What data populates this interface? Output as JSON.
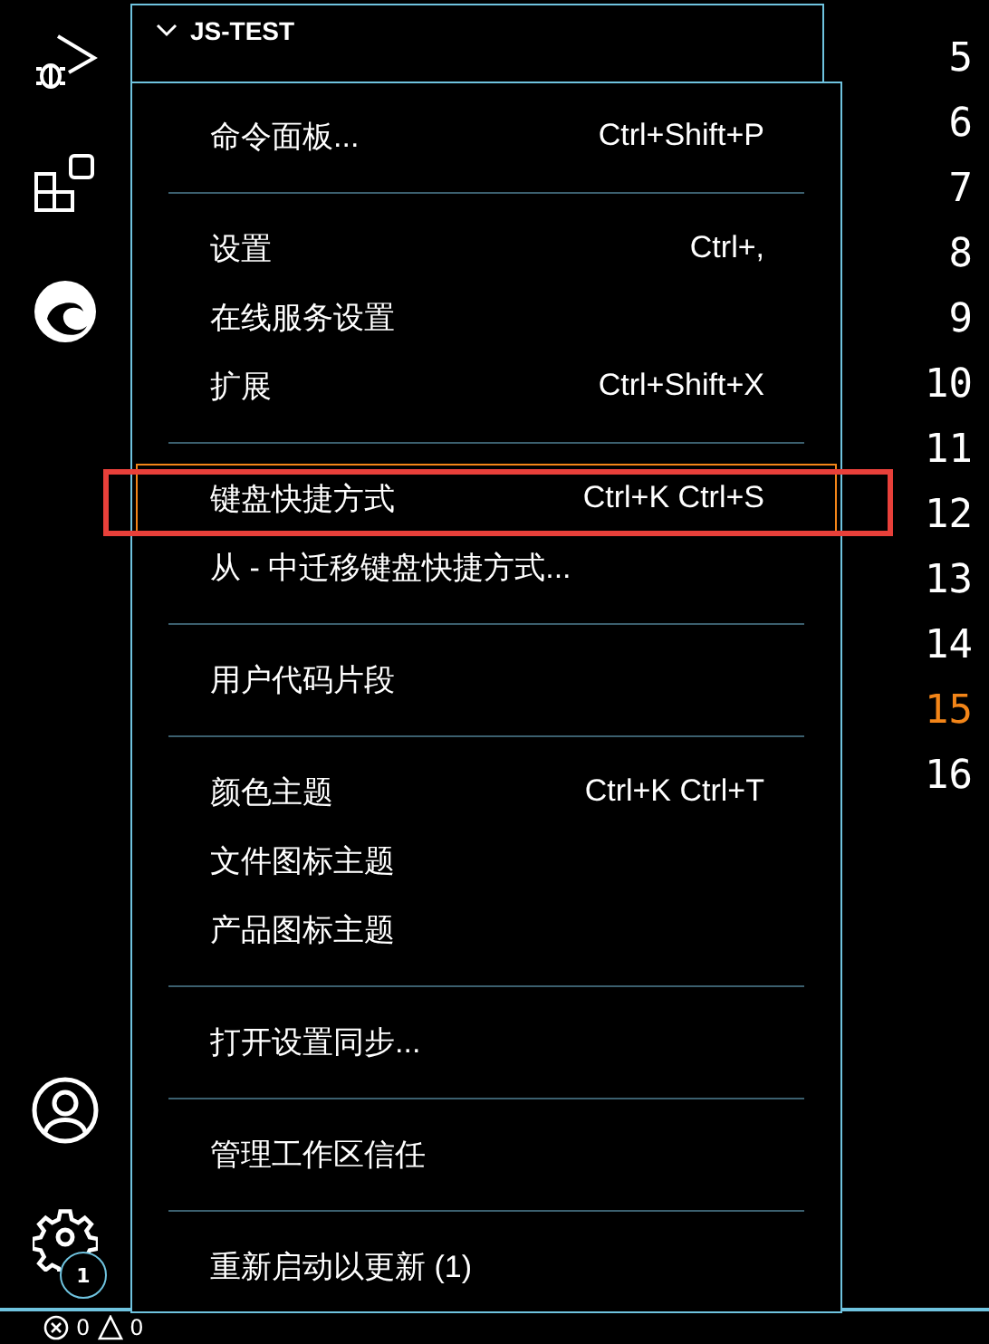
{
  "sidebar": {
    "section": {
      "title": "JS-TEST",
      "expanded": true
    }
  },
  "activity_bar": {
    "settings_badge": "1"
  },
  "menu": {
    "groups": [
      {
        "items": [
          {
            "label": "命令面板...",
            "shortcut": "Ctrl+Shift+P",
            "selected": false
          }
        ]
      },
      {
        "items": [
          {
            "label": "设置",
            "shortcut": "Ctrl+,",
            "selected": false
          },
          {
            "label": "在线服务设置",
            "selected": false
          },
          {
            "label": "扩展",
            "shortcut": "Ctrl+Shift+X",
            "selected": false
          }
        ]
      },
      {
        "items": [
          {
            "label": "键盘快捷方式",
            "shortcut": "Ctrl+K Ctrl+S",
            "selected": true
          },
          {
            "label": "从 - 中迁移键盘快捷方式...",
            "selected": false
          }
        ]
      },
      {
        "items": [
          {
            "label": "用户代码片段",
            "selected": false
          }
        ]
      },
      {
        "items": [
          {
            "label": "颜色主题",
            "shortcut": "Ctrl+K Ctrl+T",
            "selected": false
          },
          {
            "label": "文件图标主题",
            "selected": false
          },
          {
            "label": "产品图标主题",
            "selected": false
          }
        ]
      },
      {
        "items": [
          {
            "label": "打开设置同步...",
            "selected": false
          }
        ]
      },
      {
        "items": [
          {
            "label": "管理工作区信任",
            "selected": false
          }
        ]
      },
      {
        "items": [
          {
            "label": "重新启动以更新 (1)",
            "selected": false
          }
        ]
      }
    ]
  },
  "editor": {
    "line_numbers": [
      {
        "number": "5",
        "current": false
      },
      {
        "number": "6",
        "current": false
      },
      {
        "number": "7",
        "current": false
      },
      {
        "number": "8",
        "current": false
      },
      {
        "number": "9",
        "current": false
      },
      {
        "number": "10",
        "current": false
      },
      {
        "number": "11",
        "current": false
      },
      {
        "number": "12",
        "current": false
      },
      {
        "number": "13",
        "current": false
      },
      {
        "number": "14",
        "current": false
      },
      {
        "number": "15",
        "current": true
      },
      {
        "number": "16",
        "current": false
      }
    ]
  },
  "status_bar": {
    "errors": "0",
    "warnings": "0"
  }
}
